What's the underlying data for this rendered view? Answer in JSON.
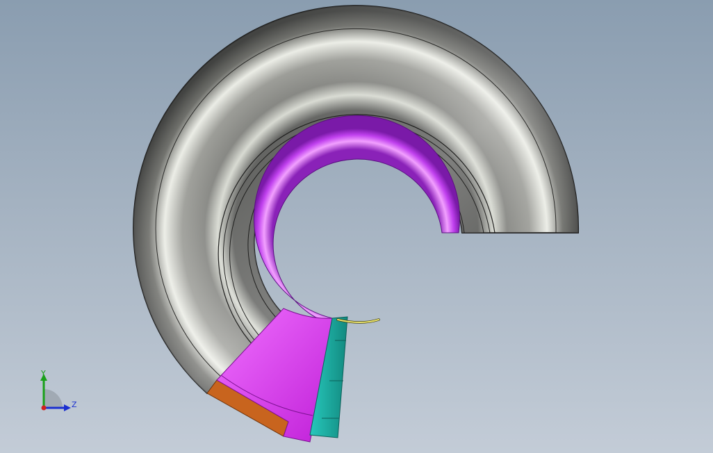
{
  "viewport": {
    "background_top": "#8a9db0",
    "background_bottom": "#c3ccd7"
  },
  "model": {
    "tire_color": "#4a4b47",
    "tire_highlight": "#f5f7f0",
    "rim_color": "#b43ce6",
    "rim_highlight": "#f090ff",
    "section_magenta": "#e040f0",
    "section_orange": "#c8641e",
    "section_teal": "#1fb5aa",
    "valve_color": "#e8e050"
  },
  "triad": {
    "y_label": "Y",
    "z_label": "Z",
    "y_color": "#1aa01a",
    "z_color": "#1a2fd0",
    "origin_color": "#d02020"
  }
}
